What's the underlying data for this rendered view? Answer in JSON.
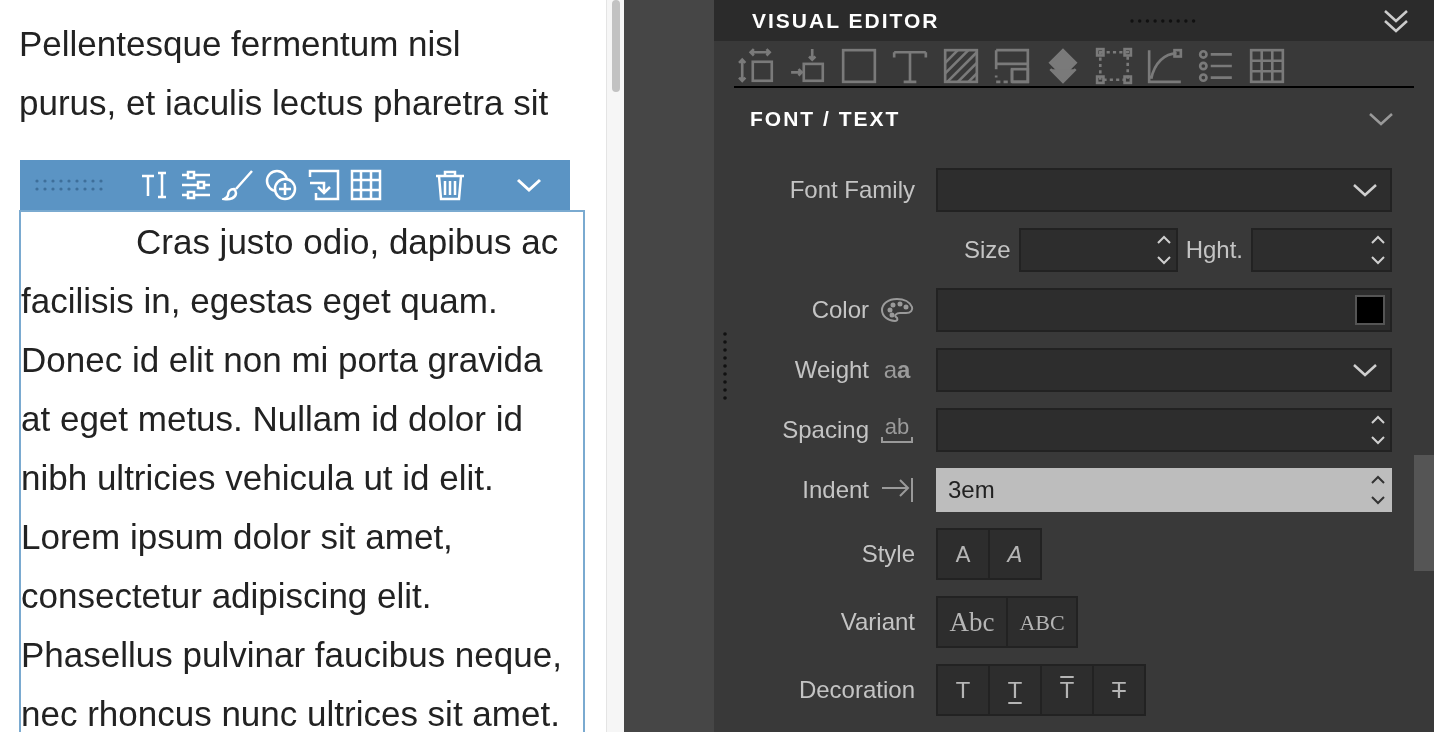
{
  "editor": {
    "paragraph_above": [
      "Pellentesque fermentum nisl",
      "purus, et iaculis lectus pharetra sit"
    ],
    "selected_paragraph": {
      "lines": [
        "Cras justo odio, dapibus ac",
        "facilisis in, egestas eget quam.",
        "Donec id elit non mi porta gravida",
        "at eget metus. Nullam id dolor id",
        "nibh ultricies vehicula ut id elit.",
        "Lorem ipsum dolor sit amet,",
        "consectetur adipiscing elit.",
        "Phasellus pulvinar faucibus neque,",
        "nec rhoncus nunc ultrices sit amet."
      ]
    }
  },
  "panel": {
    "title": "VISUAL EDITOR",
    "section": {
      "title": "FONT / TEXT",
      "expanded": true
    },
    "fields": [
      {
        "kind": "select",
        "label": "Font Family",
        "focused": false
      },
      {
        "kind": "pair",
        "items": [
          {
            "label": "Size",
            "focused": false
          },
          {
            "label": "Hght.",
            "focused": false
          }
        ]
      },
      {
        "kind": "color",
        "label": "Color",
        "color": "#000000",
        "focused": false
      },
      {
        "kind": "select",
        "label": "Weight",
        "glyph": "a**a**",
        "focused": false
      },
      {
        "kind": "number",
        "label": "Spacing",
        "glyph": "ab",
        "focused": false
      },
      {
        "kind": "indent",
        "label": "Indent",
        "value": "3em",
        "focused": true
      },
      {
        "kind": "buttons",
        "label": "Style",
        "options": [
          {
            "label": "A",
            "kind": "normal"
          },
          {
            "label": "A",
            "kind": "italic"
          }
        ]
      },
      {
        "kind": "buttons",
        "label": "Variant",
        "options": [
          {
            "label": "Abc",
            "kind": "serif"
          },
          {
            "label": "ABC",
            "kind": "smallcaps"
          }
        ]
      },
      {
        "kind": "buttons",
        "label": "Decoration",
        "options": [
          {
            "label": "T",
            "kind": "none"
          },
          {
            "label": "T",
            "kind": "underline"
          },
          {
            "label": "T",
            "kind": "overline"
          },
          {
            "label": "T",
            "kind": "strike"
          }
        ]
      }
    ]
  }
}
